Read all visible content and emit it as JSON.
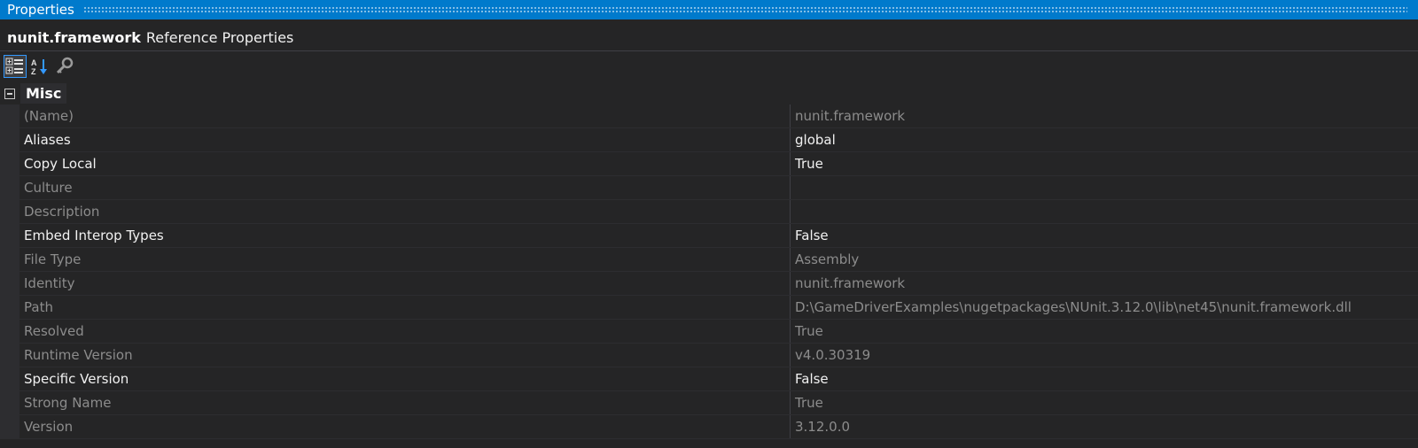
{
  "window": {
    "title": "Properties"
  },
  "subject": {
    "name": "nunit.framework",
    "kind": "Reference Properties"
  },
  "toolbar": {
    "buttons": [
      {
        "icon": "categorized-icon",
        "active": true
      },
      {
        "icon": "alphabetical-icon",
        "active": false
      },
      {
        "icon": "property-pages-icon",
        "active": false
      }
    ]
  },
  "category": {
    "label": "Misc"
  },
  "properties": [
    {
      "name": "(Name)",
      "value": "nunit.framework",
      "editable": false
    },
    {
      "name": "Aliases",
      "value": "global",
      "editable": true
    },
    {
      "name": "Copy Local",
      "value": "True",
      "editable": true
    },
    {
      "name": "Culture",
      "value": "",
      "editable": false
    },
    {
      "name": "Description",
      "value": "",
      "editable": false
    },
    {
      "name": "Embed Interop Types",
      "value": "False",
      "editable": true
    },
    {
      "name": "File Type",
      "value": "Assembly",
      "editable": false
    },
    {
      "name": "Identity",
      "value": "nunit.framework",
      "editable": false
    },
    {
      "name": "Path",
      "value": "D:\\GameDriverExamples\\nugetpackages\\NUnit.3.12.0\\lib\\net45\\nunit.framework.dll",
      "editable": false
    },
    {
      "name": "Resolved",
      "value": "True",
      "editable": false
    },
    {
      "name": "Runtime Version",
      "value": "v4.0.30319",
      "editable": false
    },
    {
      "name": "Specific Version",
      "value": "False",
      "editable": true
    },
    {
      "name": "Strong Name",
      "value": "True",
      "editable": false
    },
    {
      "name": "Version",
      "value": "3.12.0.0",
      "editable": false
    }
  ],
  "colors": {
    "accent": "#007acc",
    "background": "#252526",
    "text_enabled": "#f1f1f1",
    "text_readonly": "#8c8c8c"
  }
}
